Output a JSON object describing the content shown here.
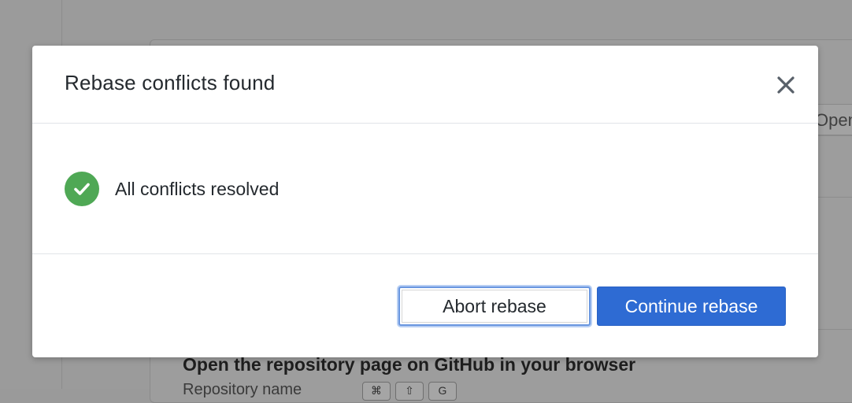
{
  "background": {
    "open_button_label": "Open",
    "hint_title": "Open the repository page on GitHub in your browser",
    "hint_subtitle": "Repository name",
    "shortcut_keys": [
      "⌘",
      "⇧",
      "G"
    ]
  },
  "dialog": {
    "title": "Rebase conflicts found",
    "close_icon": "close-icon",
    "status": {
      "icon": "check-circle-icon",
      "text": "All conflicts resolved",
      "color": "#4fa855"
    },
    "buttons": {
      "abort_label": "Abort rebase",
      "continue_label": "Continue rebase"
    },
    "colors": {
      "primary": "#2e6bd3",
      "focus_ring": "#6a97e0"
    }
  }
}
